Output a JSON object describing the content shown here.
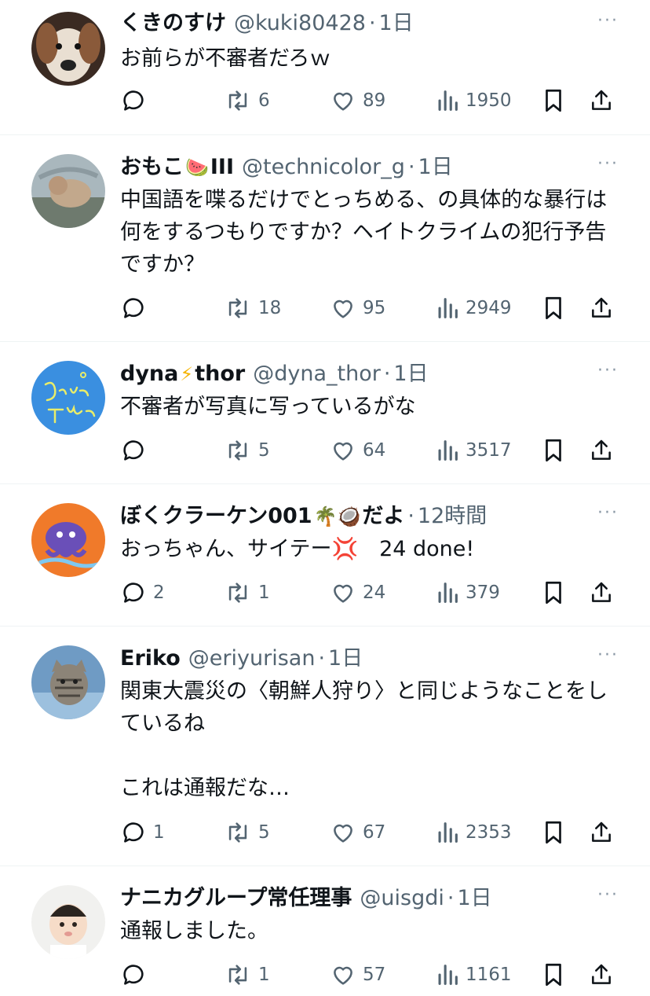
{
  "tweets": [
    {
      "name": "くきのすけ",
      "emoji": "",
      "name_suffix": "",
      "handle": "@kuki80428",
      "time": "1日",
      "text": "お前らが不審者だろｗ",
      "replies": "",
      "retweets": "6",
      "likes": "89",
      "views": "1950",
      "avatar_icon": "dog-photo-avatar"
    },
    {
      "name": "おもこ",
      "emoji": "🍉",
      "name_suffix": "III",
      "handle": "@technicolor_g",
      "time": "1日",
      "text": "中国語を喋るだけでとっちめる、の具体的な暴行は何をするつもりですか？ヘイトクライムの犯行予告ですか？",
      "replies": "",
      "retweets": "18",
      "likes": "95",
      "views": "2949",
      "avatar_icon": "cat-photo-avatar"
    },
    {
      "name": "dyna",
      "emoji": "⚡",
      "name_suffix": "thor",
      "handle": "@dyna_thor",
      "time": "1日",
      "text": "不審者が写真に写っているがな",
      "replies": "",
      "retweets": "5",
      "likes": "64",
      "views": "3517",
      "avatar_icon": "dyna-thor-logo-avatar"
    },
    {
      "name": "ぼくクラーケン001",
      "emoji": "🌴🥥",
      "name_suffix": "だよ",
      "handle": "",
      "time": "12時間",
      "text": "おっちゃん、サイテー💢　24 done!",
      "replies": "2",
      "retweets": "1",
      "likes": "24",
      "views": "379",
      "avatar_icon": "kraken-avatar"
    },
    {
      "name": "Eriko",
      "emoji": "",
      "name_suffix": "",
      "handle": "@eriyurisan",
      "time": "1日",
      "text": "関東大震災の〈朝鮮人狩り〉と同じようなことをしているね\n\nこれは通報だな…",
      "replies": "1",
      "retweets": "5",
      "likes": "67",
      "views": "2353",
      "avatar_icon": "tabby-cat-avatar"
    },
    {
      "name": "ナニカグループ常任理事",
      "emoji": "",
      "name_suffix": "",
      "handle": "@uisgdi",
      "time": "1日",
      "text": "通報しました。",
      "replies": "",
      "retweets": "1",
      "likes": "57",
      "views": "1161",
      "avatar_icon": "baby-photo-avatar"
    }
  ],
  "dot": "·",
  "more_label": "···",
  "colors": {
    "text": "#0f1419",
    "secondary": "#536471",
    "divider": "#eff3f4"
  }
}
